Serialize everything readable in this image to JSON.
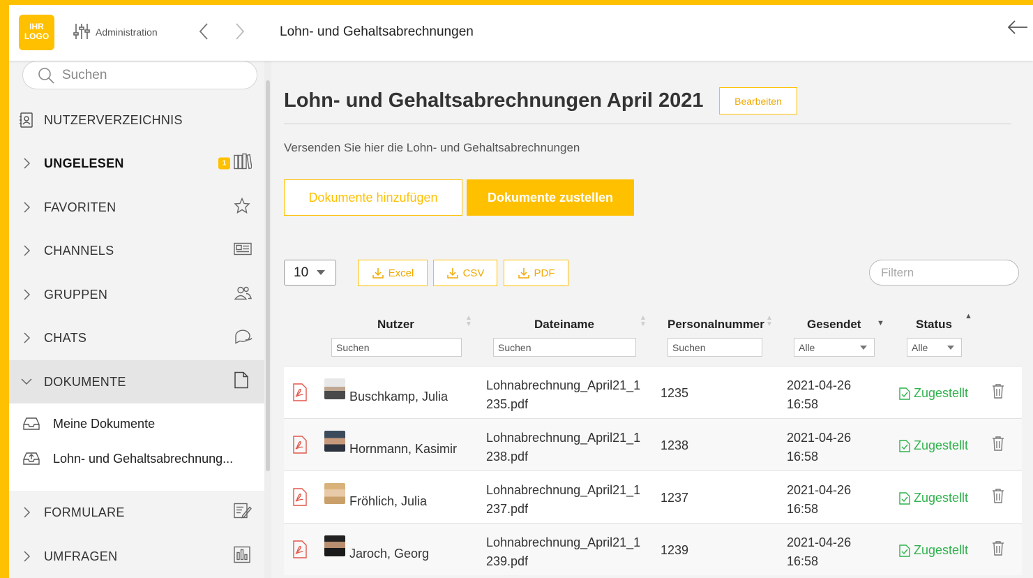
{
  "header": {
    "logo_line1": "IHR",
    "logo_line2": "LOGO",
    "admin_label": "Administration",
    "title": "Lohn- und Gehaltsabrechnungen"
  },
  "sidebar": {
    "search_placeholder": "Suchen",
    "items": [
      {
        "label": "NUTZERVERZEICHNIS",
        "icon": "address-book-icon"
      },
      {
        "label": "UNGELESEN",
        "icon": "books-icon",
        "badge": "1"
      },
      {
        "label": "FAVORITEN",
        "icon": "star-icon"
      },
      {
        "label": "CHANNELS",
        "icon": "newspaper-icon"
      },
      {
        "label": "GRUPPEN",
        "icon": "users-icon"
      },
      {
        "label": "CHATS",
        "icon": "chat-icon"
      },
      {
        "label": "DOKUMENTE",
        "icon": "document-icon"
      },
      {
        "label": "FORMULARE",
        "icon": "form-icon"
      },
      {
        "label": "UMFRAGEN",
        "icon": "poll-icon"
      }
    ],
    "sub_items": [
      {
        "label": "Meine Dokumente",
        "icon": "inbox-icon"
      },
      {
        "label": "Lohn- und Gehaltsabrechnung...",
        "icon": "inbox-upload-icon"
      }
    ]
  },
  "main": {
    "page_title": "Lohn- und Gehaltsabrechnungen April 2021",
    "edit_label": "Bearbeiten",
    "description": "Versenden Sie hier die Lohn- und Gehaltsabrechnungen",
    "add_docs_label": "Dokumente hinzufügen",
    "send_docs_label": "Dokumente zustellen",
    "per_page": "10",
    "export": {
      "excel": "Excel",
      "csv": "CSV",
      "pdf": "PDF"
    },
    "filter_placeholder": "Filtern"
  },
  "table": {
    "columns": [
      "Nutzer",
      "Dateiname",
      "Personalnummer",
      "Gesendet",
      "Status"
    ],
    "search_placeholder": "Suchen",
    "select_all": "Alle",
    "rows": [
      {
        "name": "Buschkamp, Julia",
        "file_line1": "Lohnabrechnung_April21_1",
        "file_line2": "235.pdf",
        "pnr": "1235",
        "date": "2021-04-26",
        "time": "16:58",
        "status": "Zugestellt"
      },
      {
        "name": "Hornmann, Kasimir",
        "file_line1": "Lohnabrechnung_April21_1",
        "file_line2": "238.pdf",
        "pnr": "1238",
        "date": "2021-04-26",
        "time": "16:58",
        "status": "Zugestellt"
      },
      {
        "name": "Fröhlich, Julia",
        "file_line1": "Lohnabrechnung_April21_1",
        "file_line2": "237.pdf",
        "pnr": "1237",
        "date": "2021-04-26",
        "time": "16:58",
        "status": "Zugestellt"
      },
      {
        "name": "Jaroch, Georg",
        "file_line1": "Lohnabrechnung_April21_1",
        "file_line2": "239.pdf",
        "pnr": "1239",
        "date": "2021-04-26",
        "time": "16:58",
        "status": "Zugestellt"
      }
    ]
  },
  "colors": {
    "accent": "#ffc000",
    "status_green": "#2fb24c",
    "pdf_red": "#e2574c"
  }
}
